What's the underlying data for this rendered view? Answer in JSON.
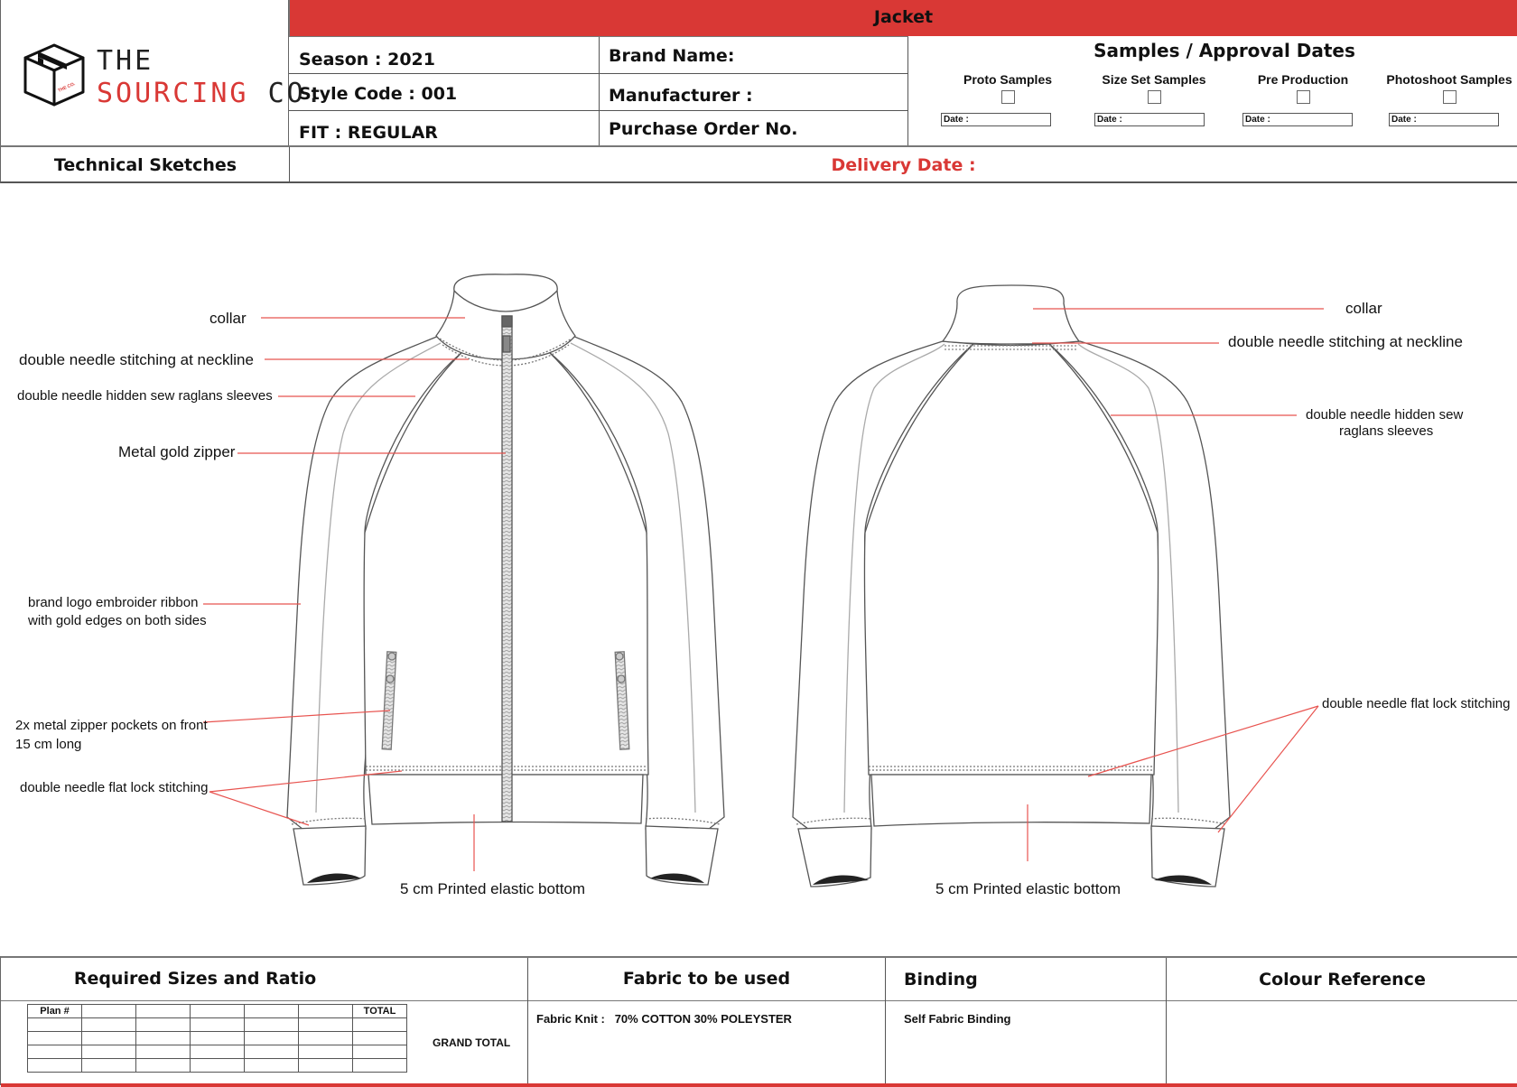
{
  "brand": {
    "line1": "THE",
    "line2_red": "SOURCING",
    "line2_black": "CO.",
    "box_label": "THE SOURCING CO."
  },
  "header": {
    "title": "Jacket",
    "season_label": "Season :  2021",
    "style_code_label": "Style Code :  001",
    "fit_label": "FIT : REGULAR",
    "brand_name_label": "Brand Name:",
    "manufacturer_label": "Manufacturer :",
    "po_label": "Purchase Order No.",
    "section_label": "Technical Sketches",
    "delivery_label": "Delivery Date :"
  },
  "samples": {
    "title": "Samples / Approval Dates",
    "items": [
      {
        "label": "Proto Samples",
        "checked": false,
        "date_label": "Date :"
      },
      {
        "label": "Size Set Samples",
        "checked": false,
        "date_label": "Date :"
      },
      {
        "label": "Pre Production",
        "checked": false,
        "date_label": "Date :"
      },
      {
        "label": "Photoshoot Samples",
        "checked": false,
        "date_label": "Date :"
      }
    ]
  },
  "front_annotations": {
    "collar": "collar",
    "neckline": "double needle stitching at neckline",
    "raglan": "double needle hidden sew raglans sleeves",
    "zipper": "Metal gold zipper",
    "ribbon_line1": "brand logo embroider ribbon",
    "ribbon_line2": "with gold edges on both sides",
    "pockets_line1": "2x metal zipper pockets on front",
    "pockets_line2": "15 cm long",
    "flatlock": "double needle flat lock stitching",
    "elastic": "5 cm Printed elastic bottom"
  },
  "back_annotations": {
    "collar": "collar",
    "neckline": "double needle stitching at neckline",
    "raglan_line1": "double needle hidden sew",
    "raglan_line2": "raglans sleeves",
    "flatlock": "double needle flat lock stitching",
    "elastic": "5 cm Printed elastic bottom"
  },
  "bottom": {
    "sizes_title": "Required Sizes and Ratio",
    "sizes_table": {
      "header": [
        "Plan #",
        "",
        "",
        "",
        "",
        "",
        "TOTAL"
      ],
      "rows": [
        [
          "",
          "",
          "",
          "",
          "",
          "",
          ""
        ],
        [
          "",
          "",
          "",
          "",
          "",
          "",
          ""
        ],
        [
          "",
          "",
          "",
          "",
          "",
          "",
          ""
        ],
        [
          "",
          "",
          "",
          "",
          "",
          "",
          ""
        ]
      ]
    },
    "grand_total_label": "GRAND TOTAL",
    "fabric_title": "Fabric to be used",
    "fabric_label": "Fabric Knit :",
    "fabric_value": "70% COTTON 30% POLEYSTER",
    "binding_title": "Binding",
    "binding_value": "Self Fabric Binding",
    "colour_title": "Colour Reference"
  },
  "colors": {
    "accent_red": "#d93835",
    "annotation_line": "#e8534f",
    "border": "#555555"
  }
}
